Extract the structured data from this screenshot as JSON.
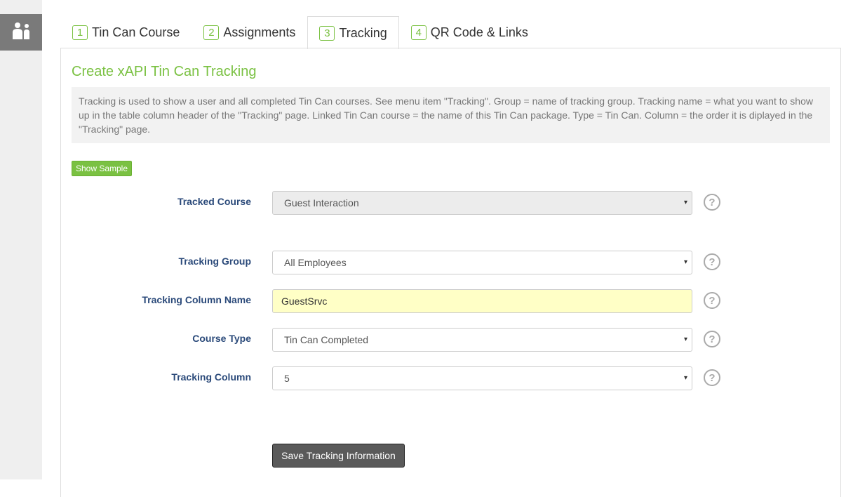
{
  "sidebar": {
    "top_icon": "gear-icon",
    "users_icon": "users-icon"
  },
  "tabs": [
    {
      "num": "1",
      "label": "Tin Can Course"
    },
    {
      "num": "2",
      "label": "Assignments"
    },
    {
      "num": "3",
      "label": "Tracking"
    },
    {
      "num": "4",
      "label": "QR Code & Links"
    }
  ],
  "active_tab": "Tracking",
  "page": {
    "title": "Create xAPI Tin Can Tracking",
    "info": "Tracking is used to show a user and all completed Tin Can courses. See menu item \"Tracking\". Group = name of tracking group. Tracking name = what you want to show up in the table column header of the \"Tracking\" page. Linked Tin Can course = the name of this Tin Can package. Type = Tin Can. Column = the order it is diplayed in the \"Tracking\" page.",
    "show_sample_label": "Show Sample"
  },
  "form": {
    "tracked_course": {
      "label": "Tracked Course",
      "value": "Guest Interaction"
    },
    "tracking_group": {
      "label": "Tracking Group",
      "value": "All Employees"
    },
    "column_name": {
      "label": "Tracking Column Name",
      "value": "GuestSrvc"
    },
    "course_type": {
      "label": "Course Type",
      "value": "Tin Can Completed"
    },
    "tracking_column": {
      "label": "Tracking Column",
      "value": "5"
    },
    "help_glyph": "?",
    "caret_glyph": "▾"
  },
  "save_label": "Save Tracking Information",
  "colors": {
    "accent": "#7ac142",
    "label": "#2b4a7a",
    "input_highlight": "#ffffc6"
  }
}
